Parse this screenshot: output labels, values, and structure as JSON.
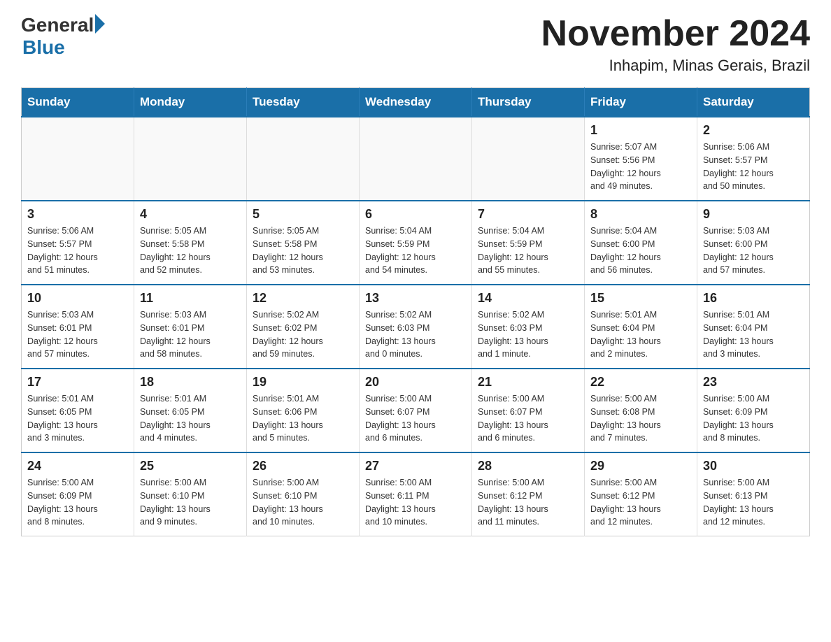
{
  "header": {
    "logo_general": "General",
    "logo_blue": "Blue",
    "title": "November 2024",
    "subtitle": "Inhapim, Minas Gerais, Brazil"
  },
  "weekdays": [
    "Sunday",
    "Monday",
    "Tuesday",
    "Wednesday",
    "Thursday",
    "Friday",
    "Saturday"
  ],
  "weeks": [
    [
      {
        "day": "",
        "info": ""
      },
      {
        "day": "",
        "info": ""
      },
      {
        "day": "",
        "info": ""
      },
      {
        "day": "",
        "info": ""
      },
      {
        "day": "",
        "info": ""
      },
      {
        "day": "1",
        "info": "Sunrise: 5:07 AM\nSunset: 5:56 PM\nDaylight: 12 hours\nand 49 minutes."
      },
      {
        "day": "2",
        "info": "Sunrise: 5:06 AM\nSunset: 5:57 PM\nDaylight: 12 hours\nand 50 minutes."
      }
    ],
    [
      {
        "day": "3",
        "info": "Sunrise: 5:06 AM\nSunset: 5:57 PM\nDaylight: 12 hours\nand 51 minutes."
      },
      {
        "day": "4",
        "info": "Sunrise: 5:05 AM\nSunset: 5:58 PM\nDaylight: 12 hours\nand 52 minutes."
      },
      {
        "day": "5",
        "info": "Sunrise: 5:05 AM\nSunset: 5:58 PM\nDaylight: 12 hours\nand 53 minutes."
      },
      {
        "day": "6",
        "info": "Sunrise: 5:04 AM\nSunset: 5:59 PM\nDaylight: 12 hours\nand 54 minutes."
      },
      {
        "day": "7",
        "info": "Sunrise: 5:04 AM\nSunset: 5:59 PM\nDaylight: 12 hours\nand 55 minutes."
      },
      {
        "day": "8",
        "info": "Sunrise: 5:04 AM\nSunset: 6:00 PM\nDaylight: 12 hours\nand 56 minutes."
      },
      {
        "day": "9",
        "info": "Sunrise: 5:03 AM\nSunset: 6:00 PM\nDaylight: 12 hours\nand 57 minutes."
      }
    ],
    [
      {
        "day": "10",
        "info": "Sunrise: 5:03 AM\nSunset: 6:01 PM\nDaylight: 12 hours\nand 57 minutes."
      },
      {
        "day": "11",
        "info": "Sunrise: 5:03 AM\nSunset: 6:01 PM\nDaylight: 12 hours\nand 58 minutes."
      },
      {
        "day": "12",
        "info": "Sunrise: 5:02 AM\nSunset: 6:02 PM\nDaylight: 12 hours\nand 59 minutes."
      },
      {
        "day": "13",
        "info": "Sunrise: 5:02 AM\nSunset: 6:03 PM\nDaylight: 13 hours\nand 0 minutes."
      },
      {
        "day": "14",
        "info": "Sunrise: 5:02 AM\nSunset: 6:03 PM\nDaylight: 13 hours\nand 1 minute."
      },
      {
        "day": "15",
        "info": "Sunrise: 5:01 AM\nSunset: 6:04 PM\nDaylight: 13 hours\nand 2 minutes."
      },
      {
        "day": "16",
        "info": "Sunrise: 5:01 AM\nSunset: 6:04 PM\nDaylight: 13 hours\nand 3 minutes."
      }
    ],
    [
      {
        "day": "17",
        "info": "Sunrise: 5:01 AM\nSunset: 6:05 PM\nDaylight: 13 hours\nand 3 minutes."
      },
      {
        "day": "18",
        "info": "Sunrise: 5:01 AM\nSunset: 6:05 PM\nDaylight: 13 hours\nand 4 minutes."
      },
      {
        "day": "19",
        "info": "Sunrise: 5:01 AM\nSunset: 6:06 PM\nDaylight: 13 hours\nand 5 minutes."
      },
      {
        "day": "20",
        "info": "Sunrise: 5:00 AM\nSunset: 6:07 PM\nDaylight: 13 hours\nand 6 minutes."
      },
      {
        "day": "21",
        "info": "Sunrise: 5:00 AM\nSunset: 6:07 PM\nDaylight: 13 hours\nand 6 minutes."
      },
      {
        "day": "22",
        "info": "Sunrise: 5:00 AM\nSunset: 6:08 PM\nDaylight: 13 hours\nand 7 minutes."
      },
      {
        "day": "23",
        "info": "Sunrise: 5:00 AM\nSunset: 6:09 PM\nDaylight: 13 hours\nand 8 minutes."
      }
    ],
    [
      {
        "day": "24",
        "info": "Sunrise: 5:00 AM\nSunset: 6:09 PM\nDaylight: 13 hours\nand 8 minutes."
      },
      {
        "day": "25",
        "info": "Sunrise: 5:00 AM\nSunset: 6:10 PM\nDaylight: 13 hours\nand 9 minutes."
      },
      {
        "day": "26",
        "info": "Sunrise: 5:00 AM\nSunset: 6:10 PM\nDaylight: 13 hours\nand 10 minutes."
      },
      {
        "day": "27",
        "info": "Sunrise: 5:00 AM\nSunset: 6:11 PM\nDaylight: 13 hours\nand 10 minutes."
      },
      {
        "day": "28",
        "info": "Sunrise: 5:00 AM\nSunset: 6:12 PM\nDaylight: 13 hours\nand 11 minutes."
      },
      {
        "day": "29",
        "info": "Sunrise: 5:00 AM\nSunset: 6:12 PM\nDaylight: 13 hours\nand 12 minutes."
      },
      {
        "day": "30",
        "info": "Sunrise: 5:00 AM\nSunset: 6:13 PM\nDaylight: 13 hours\nand 12 minutes."
      }
    ]
  ]
}
